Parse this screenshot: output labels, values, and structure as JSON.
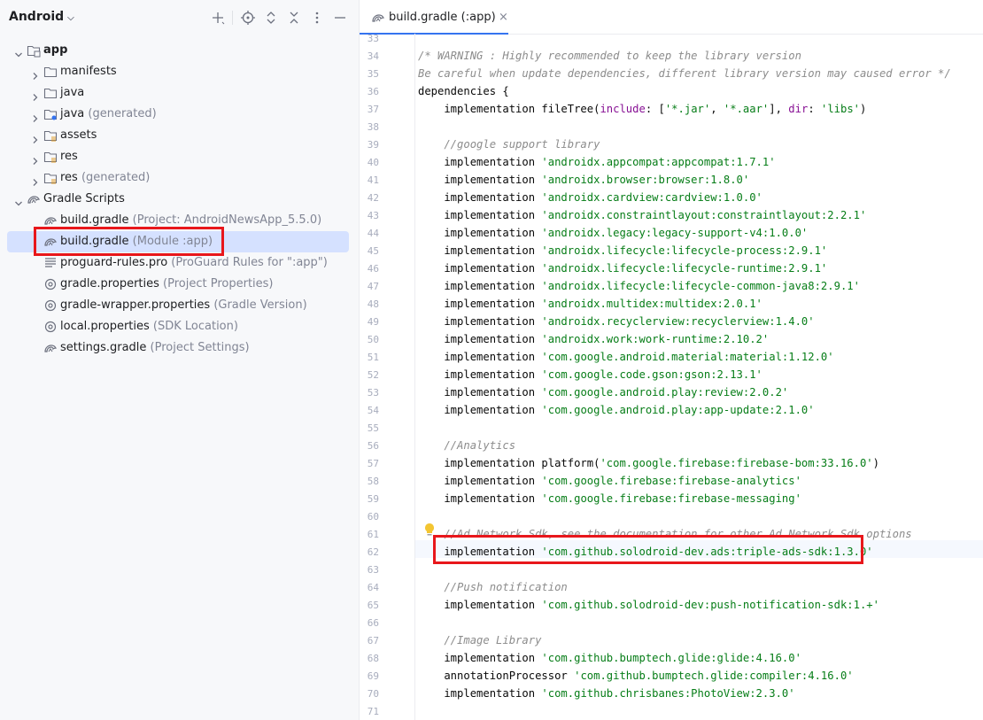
{
  "project_panel": {
    "title": "Android",
    "tree": [
      {
        "label": "app",
        "hint": "",
        "icon": "module-folder-icon",
        "level": 0,
        "expanded": true,
        "bold": true
      },
      {
        "label": "manifests",
        "hint": "",
        "icon": "folder-icon",
        "level": 1,
        "expanded": false
      },
      {
        "label": "java",
        "hint": "",
        "icon": "folder-icon",
        "level": 1,
        "expanded": false
      },
      {
        "label": "java",
        "hint": "(generated)",
        "icon": "generated-folder-icon",
        "level": 1,
        "expanded": false
      },
      {
        "label": "assets",
        "hint": "",
        "icon": "resource-folder-icon",
        "level": 1,
        "expanded": false
      },
      {
        "label": "res",
        "hint": "",
        "icon": "resource-folder-icon",
        "level": 1,
        "expanded": false
      },
      {
        "label": "res",
        "hint": "(generated)",
        "icon": "resource-folder-icon",
        "level": 1,
        "expanded": false
      },
      {
        "label": "Gradle Scripts",
        "hint": "",
        "icon": "gradle-icon",
        "level": 0,
        "expanded": true
      },
      {
        "label": "build.gradle",
        "hint": "(Project: AndroidNewsApp_5.5.0)",
        "icon": "gradle-icon",
        "level": 1
      },
      {
        "label": "build.gradle",
        "hint": "(Module :app)",
        "icon": "gradle-icon",
        "level": 1,
        "selected": true
      },
      {
        "label": "proguard-rules.pro",
        "hint": "(ProGuard Rules for \":app\")",
        "icon": "text-file-icon",
        "level": 1
      },
      {
        "label": "gradle.properties",
        "hint": "(Project Properties)",
        "icon": "settings-file-icon",
        "level": 1
      },
      {
        "label": "gradle-wrapper.properties",
        "hint": "(Gradle Version)",
        "icon": "settings-file-icon",
        "level": 1
      },
      {
        "label": "local.properties",
        "hint": "(SDK Location)",
        "icon": "settings-file-icon",
        "level": 1
      },
      {
        "label": "settings.gradle",
        "hint": "(Project Settings)",
        "icon": "gradle-icon",
        "level": 1
      }
    ]
  },
  "editor": {
    "tab_label": "build.gradle (:app)",
    "tab_close": "×",
    "lines": [
      {
        "n": "33",
        "segs": []
      },
      {
        "n": "34",
        "segs": [
          {
            "t": "/* WARNING : Highly recommended to keep the library version",
            "c": "cmt"
          }
        ]
      },
      {
        "n": "35",
        "segs": [
          {
            "t": "Be careful when update dependencies, different library version may caused error */",
            "c": "cmt"
          }
        ]
      },
      {
        "n": "36",
        "segs": [
          {
            "t": "dependencies {",
            "c": "kw"
          }
        ]
      },
      {
        "n": "37",
        "segs": [
          {
            "t": "    implementation fileTree(",
            "c": "kw"
          },
          {
            "t": "include",
            "c": "nm"
          },
          {
            "t": ": [",
            "c": "kw"
          },
          {
            "t": "'*.jar'",
            "c": "str"
          },
          {
            "t": ", ",
            "c": "kw"
          },
          {
            "t": "'*.aar'",
            "c": "str"
          },
          {
            "t": "], ",
            "c": "kw"
          },
          {
            "t": "dir",
            "c": "nm"
          },
          {
            "t": ": ",
            "c": "kw"
          },
          {
            "t": "'libs'",
            "c": "str"
          },
          {
            "t": ")",
            "c": "kw"
          }
        ]
      },
      {
        "n": "38",
        "segs": []
      },
      {
        "n": "39",
        "segs": [
          {
            "t": "    //google support library",
            "c": "cmt"
          }
        ]
      },
      {
        "n": "40",
        "segs": [
          {
            "t": "    implementation ",
            "c": "kw"
          },
          {
            "t": "'androidx.appcompat:appcompat:1.7.1'",
            "c": "str"
          }
        ]
      },
      {
        "n": "41",
        "segs": [
          {
            "t": "    implementation ",
            "c": "kw"
          },
          {
            "t": "'androidx.browser:browser:1.8.0'",
            "c": "str"
          }
        ]
      },
      {
        "n": "42",
        "segs": [
          {
            "t": "    implementation ",
            "c": "kw"
          },
          {
            "t": "'androidx.cardview:cardview:1.0.0'",
            "c": "str"
          }
        ]
      },
      {
        "n": "43",
        "segs": [
          {
            "t": "    implementation ",
            "c": "kw"
          },
          {
            "t": "'androidx.constraintlayout:constraintlayout:2.2.1'",
            "c": "str"
          }
        ]
      },
      {
        "n": "44",
        "segs": [
          {
            "t": "    implementation ",
            "c": "kw"
          },
          {
            "t": "'androidx.legacy:legacy-support-v4:1.0.0'",
            "c": "str"
          }
        ]
      },
      {
        "n": "45",
        "segs": [
          {
            "t": "    implementation ",
            "c": "kw"
          },
          {
            "t": "'androidx.lifecycle:lifecycle-process:2.9.1'",
            "c": "str"
          }
        ]
      },
      {
        "n": "46",
        "segs": [
          {
            "t": "    implementation ",
            "c": "kw"
          },
          {
            "t": "'androidx.lifecycle:lifecycle-runtime:2.9.1'",
            "c": "str"
          }
        ]
      },
      {
        "n": "47",
        "segs": [
          {
            "t": "    implementation ",
            "c": "kw"
          },
          {
            "t": "'androidx.lifecycle:lifecycle-common-java8:2.9.1'",
            "c": "str"
          }
        ]
      },
      {
        "n": "48",
        "segs": [
          {
            "t": "    implementation ",
            "c": "kw"
          },
          {
            "t": "'androidx.multidex:multidex:2.0.1'",
            "c": "str"
          }
        ]
      },
      {
        "n": "49",
        "segs": [
          {
            "t": "    implementation ",
            "c": "kw"
          },
          {
            "t": "'androidx.recyclerview:recyclerview:1.4.0'",
            "c": "str"
          }
        ]
      },
      {
        "n": "50",
        "segs": [
          {
            "t": "    implementation ",
            "c": "kw"
          },
          {
            "t": "'androidx.work:work-runtime:2.10.2'",
            "c": "str"
          }
        ]
      },
      {
        "n": "51",
        "segs": [
          {
            "t": "    implementation ",
            "c": "kw"
          },
          {
            "t": "'com.google.android.material:material:1.12.0'",
            "c": "str"
          }
        ]
      },
      {
        "n": "52",
        "segs": [
          {
            "t": "    implementation ",
            "c": "kw"
          },
          {
            "t": "'com.google.code.gson:gson:2.13.1'",
            "c": "str"
          }
        ]
      },
      {
        "n": "53",
        "segs": [
          {
            "t": "    implementation ",
            "c": "kw"
          },
          {
            "t": "'com.google.android.play:review:2.0.2'",
            "c": "str"
          }
        ]
      },
      {
        "n": "54",
        "segs": [
          {
            "t": "    implementation ",
            "c": "kw"
          },
          {
            "t": "'com.google.android.play:app-update:2.1.0'",
            "c": "str"
          }
        ]
      },
      {
        "n": "55",
        "segs": []
      },
      {
        "n": "56",
        "segs": [
          {
            "t": "    //Analytics",
            "c": "cmt"
          }
        ]
      },
      {
        "n": "57",
        "segs": [
          {
            "t": "    implementation platform(",
            "c": "kw"
          },
          {
            "t": "'com.google.firebase:firebase-bom:33.16.0'",
            "c": "str"
          },
          {
            "t": ")",
            "c": "kw"
          }
        ]
      },
      {
        "n": "58",
        "segs": [
          {
            "t": "    implementation ",
            "c": "kw"
          },
          {
            "t": "'com.google.firebase:firebase-analytics'",
            "c": "str"
          }
        ]
      },
      {
        "n": "59",
        "segs": [
          {
            "t": "    implementation ",
            "c": "kw"
          },
          {
            "t": "'com.google.firebase:firebase-messaging'",
            "c": "str"
          }
        ]
      },
      {
        "n": "60",
        "segs": []
      },
      {
        "n": "61",
        "segs": [
          {
            "t": "    //Ad Network Sdk, see the documentation for other Ad Network Sdk options",
            "c": "cmt"
          }
        ]
      },
      {
        "n": "62",
        "segs": [
          {
            "t": "    implementation ",
            "c": "kw"
          },
          {
            "t": "'com.github.solodroid-dev.ads:triple-ads-sdk:1.3.0'",
            "c": "str"
          }
        ]
      },
      {
        "n": "63",
        "segs": []
      },
      {
        "n": "64",
        "segs": [
          {
            "t": "    //Push notification",
            "c": "cmt"
          }
        ]
      },
      {
        "n": "65",
        "segs": [
          {
            "t": "    implementation ",
            "c": "kw"
          },
          {
            "t": "'com.github.solodroid-dev:push-notification-sdk:1.+'",
            "c": "str"
          }
        ]
      },
      {
        "n": "66",
        "segs": []
      },
      {
        "n": "67",
        "segs": [
          {
            "t": "    //Image Library",
            "c": "cmt"
          }
        ]
      },
      {
        "n": "68",
        "segs": [
          {
            "t": "    implementation ",
            "c": "kw"
          },
          {
            "t": "'com.github.bumptech.glide:glide:4.16.0'",
            "c": "str"
          }
        ]
      },
      {
        "n": "69",
        "segs": [
          {
            "t": "    annotationProcessor ",
            "c": "kw"
          },
          {
            "t": "'com.github.bumptech.glide:compiler:4.16.0'",
            "c": "str"
          }
        ]
      },
      {
        "n": "70",
        "segs": [
          {
            "t": "    implementation ",
            "c": "kw"
          },
          {
            "t": "'com.github.chrisbanes:PhotoView:2.3.0'",
            "c": "str"
          }
        ]
      },
      {
        "n": "71",
        "segs": []
      }
    ]
  },
  "colors": {
    "highlight": "#e8171b",
    "selection": "#d5e1ff",
    "string": "#067d17",
    "comment": "#8c8c8c"
  }
}
